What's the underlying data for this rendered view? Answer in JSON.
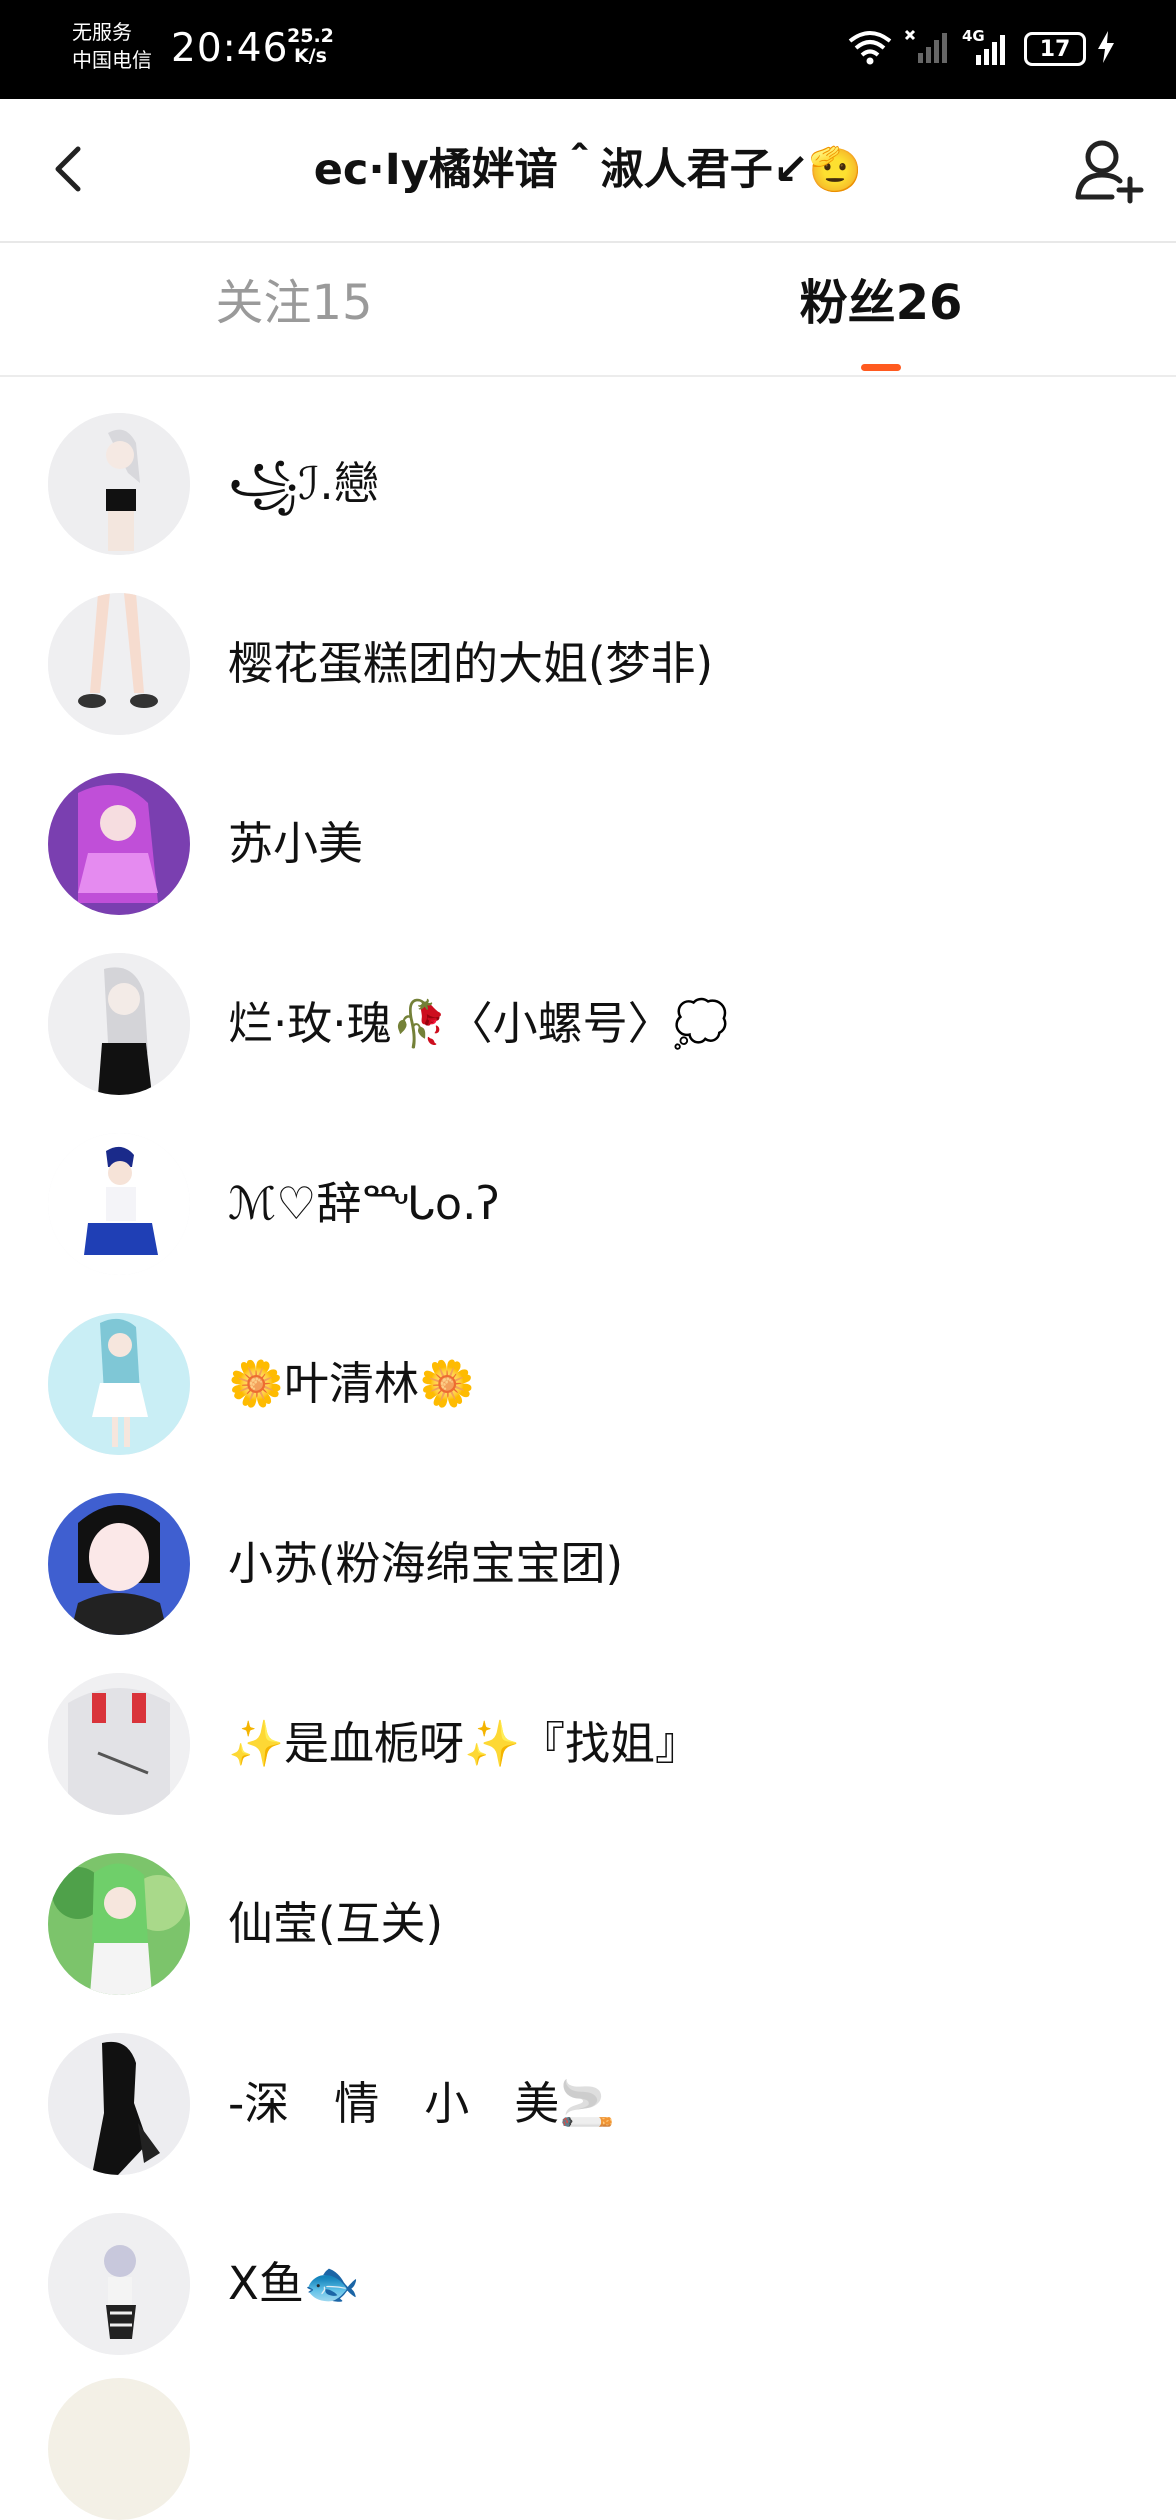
{
  "status_bar": {
    "carrier_line1": "无服务",
    "carrier_line2": "中国电信",
    "time": "20:46",
    "speed_value": "25.2",
    "speed_unit": "K/s",
    "network": "4G",
    "battery": "17"
  },
  "header": {
    "title": "ec·Iy橘姅谙＾淑人君子↙🫡"
  },
  "tabs": [
    {
      "label": "关注15",
      "selected": false
    },
    {
      "label": "粉丝26",
      "selected": true
    }
  ],
  "colors": {
    "accent": "#ff5a1f",
    "inactive_tab": "#9a9a9a"
  },
  "fans": [
    {
      "name": "꧁ℐ.戀"
    },
    {
      "name": "樱花蛋糕团的大姐(梦非)"
    },
    {
      "name": "苏小美"
    },
    {
      "name": "烂·玫·瑰🥀〈小螺号〉💭"
    },
    {
      "name": "ℳ♡辞ᙵ꧐.ʔ"
    },
    {
      "name": "🌼叶清林🌼"
    },
    {
      "name": "小苏(粉海绵宝宝团)"
    },
    {
      "name": "✨是血栀呀✨『找姐』"
    },
    {
      "name": "仙莹(互关)"
    },
    {
      "name": "-深　情　小　美🚬"
    },
    {
      "name": "X鱼🐟"
    }
  ]
}
